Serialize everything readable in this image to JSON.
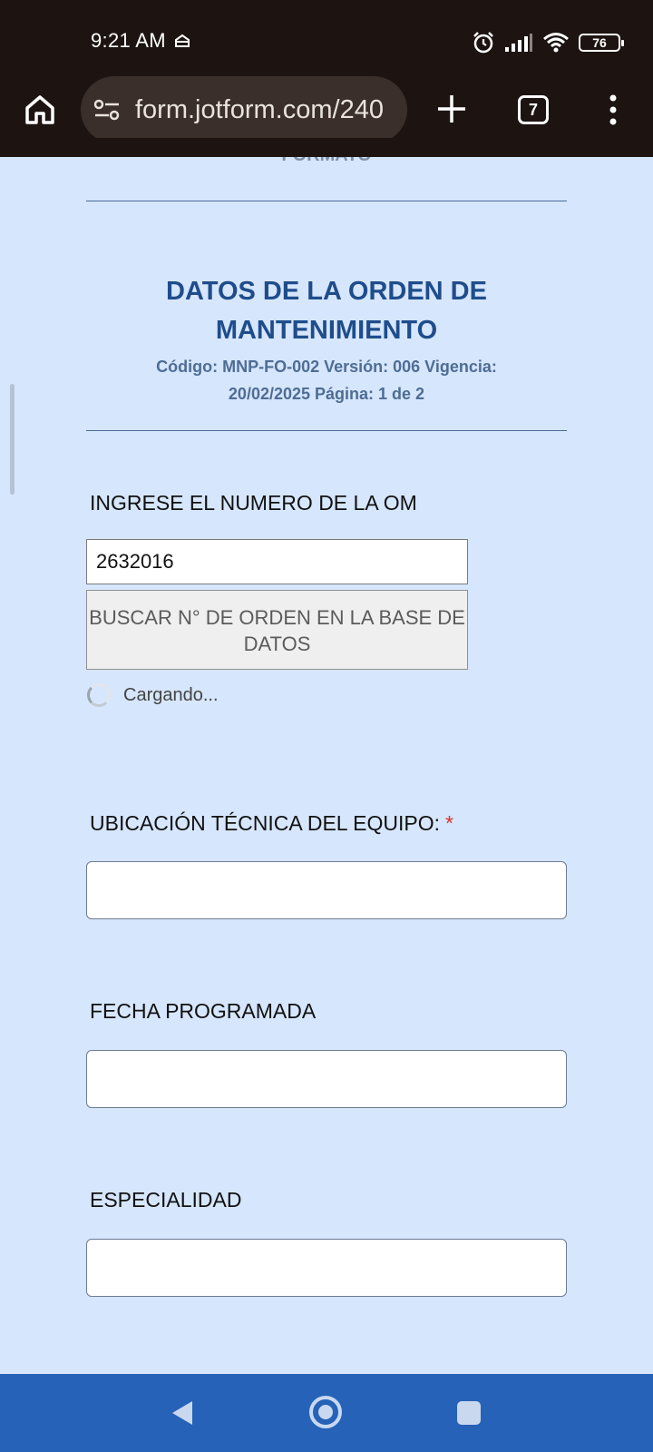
{
  "status_bar": {
    "time": "9:21 AM",
    "battery": "76"
  },
  "browser": {
    "url": "form.jotform.com/240",
    "tab_count": "7"
  },
  "page": {
    "faded_header": "FORMATO",
    "section_title": "DATOS DE LA ORDEN DE MANTENIMIENTO",
    "section_subtitle": "Código: MNP-FO-002 Versión: 006 Vigencia: 20/02/2025 Página: 1 de 2"
  },
  "form": {
    "om_label": "INGRESE EL NUMERO DE LA OM",
    "om_value": "2632016",
    "search_button": "BUSCAR N° DE ORDEN EN LA BASE DE DATOS",
    "loading_text": "Cargando...",
    "ubicacion_label": "UBICACIÓN TÉCNICA DEL EQUIPO:",
    "required_mark": "*",
    "ubicacion_value": "",
    "fecha_label": "FECHA PROGRAMADA",
    "fecha_value": "",
    "especialidad_label": "ESPECIALIDAD",
    "especialidad_value": ""
  },
  "colors": {
    "page_bg": "#d6e6fc",
    "title": "#1f4d8c",
    "navbar": "#2562b8",
    "required": "#d9342b"
  }
}
